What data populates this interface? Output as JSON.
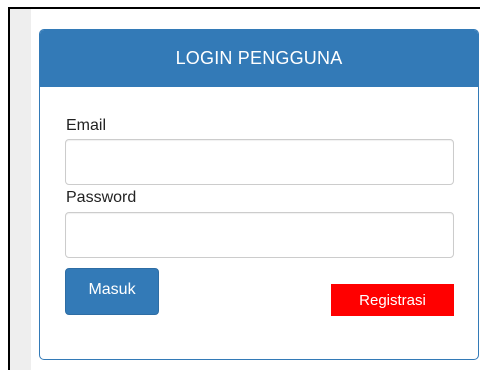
{
  "login_panel": {
    "title": "LOGIN PENGGUNA",
    "email_label": "Email",
    "email_value": "",
    "password_label": "Password",
    "password_value": "",
    "submit_label": "Masuk",
    "register_label": "Registrasi"
  },
  "colors": {
    "panel_primary": "#337ab7",
    "register_red": "#ff0000",
    "frame_border": "#000000",
    "input_border": "#cccccc"
  }
}
